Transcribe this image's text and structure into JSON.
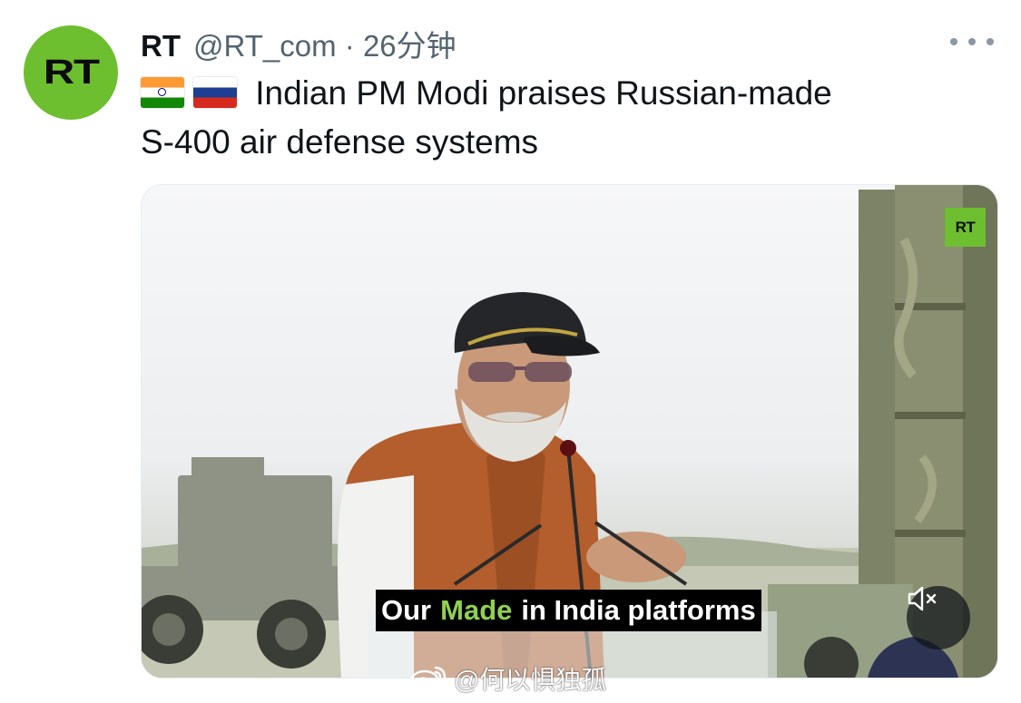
{
  "tweet": {
    "avatar_logo": "RT",
    "display_name": "RT",
    "handle": "@RT_com",
    "separator": "·",
    "time": "26分钟",
    "text_line1": "Indian PM Modi praises Russian-made",
    "text_line2": "S-400 air defense systems",
    "flags": [
      "india-flag",
      "russia-flag"
    ]
  },
  "media": {
    "channel_badge": "RT",
    "subtitle_pre": "Our",
    "subtitle_highlight": "Made",
    "subtitle_post": "in India platforms",
    "mute_icon": "speaker-muted-icon"
  },
  "watermark": {
    "text": "@何以惧独孤"
  },
  "colors": {
    "avatar_green": "#6ebf30",
    "subtitle_highlight": "#8fd14f",
    "handle_gray": "#536471"
  }
}
